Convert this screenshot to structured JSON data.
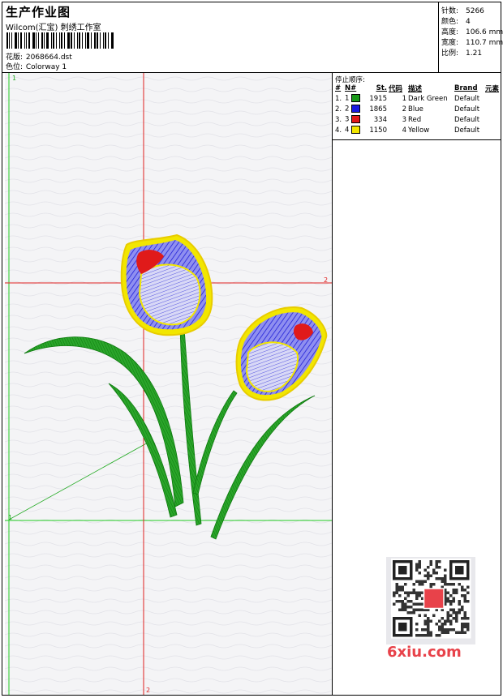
{
  "header": {
    "title": "生产作业图",
    "subtitle": "Wilcom(汇宝) 刺绣工作室",
    "design": {
      "label": "花版:",
      "value": "2068664.dst"
    },
    "colorway": {
      "label": "色位:",
      "value": "Colorway 1"
    }
  },
  "stats": [
    {
      "label": "针数:",
      "value": "5266"
    },
    {
      "label": "颜色:",
      "value": "4"
    },
    {
      "label": "高度:",
      "value": "106.6 mm"
    },
    {
      "label": "宽度:",
      "value": "110.7 mm"
    },
    {
      "label": "比例:",
      "value": "1.21"
    }
  ],
  "stop_sequence": {
    "title": "停止顺序:",
    "columns": [
      "#",
      "N#",
      "St.",
      "代码",
      "描述",
      "Brand",
      "元素"
    ],
    "rows": [
      {
        "index": "1.",
        "n": "1",
        "color": "#1a9a1a",
        "stitches": "1915",
        "code": "1",
        "desc": "Dark Green",
        "brand": "Default"
      },
      {
        "index": "2.",
        "n": "2",
        "color": "#1a1ae0",
        "stitches": "1865",
        "code": "2",
        "desc": "Blue",
        "brand": "Default"
      },
      {
        "index": "3.",
        "n": "3",
        "color": "#e01a1a",
        "stitches": "334",
        "code": "3",
        "desc": "Red",
        "brand": "Default"
      },
      {
        "index": "4.",
        "n": "4",
        "color": "#f2e600",
        "stitches": "1150",
        "code": "4",
        "desc": "Yellow",
        "brand": "Default"
      }
    ]
  },
  "canvas_markers": {
    "top_left": "1",
    "left_mid": "1",
    "right_h": "2",
    "bottom_v": "2"
  },
  "colors": {
    "green_guide": "#22cc22",
    "red_guide": "#e02020"
  },
  "watermark": {
    "logo_text": "6xiu.com",
    "icon": "qr-code-icon"
  }
}
